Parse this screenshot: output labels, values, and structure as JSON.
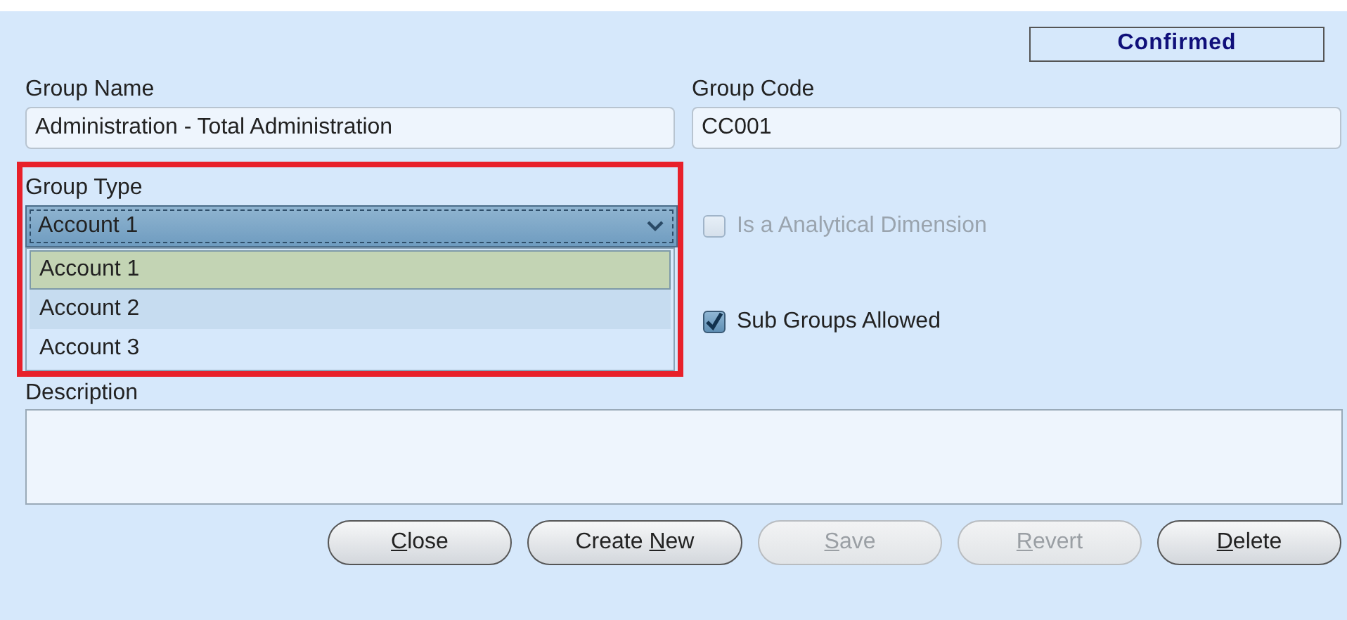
{
  "status": "Confirmed",
  "group_name": {
    "label": "Group Name",
    "value": "Administration - Total Administration"
  },
  "group_code": {
    "label": "Group Code",
    "value": "CC001"
  },
  "group_type": {
    "label": "Group Type",
    "value": "Account 1",
    "expanded": true,
    "options": [
      {
        "label": "Account 1",
        "selected": true
      },
      {
        "label": "Account 2",
        "selected": false
      },
      {
        "label": "Account 3",
        "selected": false
      }
    ]
  },
  "checkboxes": [
    {
      "label": "Is a Analytical Dimension",
      "checked": false,
      "disabled": true
    },
    {
      "label": "Sub Groups Allowed",
      "checked": true,
      "disabled": false
    }
  ],
  "description": {
    "label": "Description"
  },
  "buttons": [
    {
      "key": "C",
      "post": "lose",
      "disabled": false
    },
    {
      "pre": "Create ",
      "key": "N",
      "post": "ew",
      "disabled": false
    },
    {
      "key": "S",
      "post": "ave",
      "disabled": true
    },
    {
      "key": "R",
      "post": "evert",
      "disabled": true
    },
    {
      "key": "D",
      "post": "elete",
      "disabled": false
    }
  ],
  "highlight": true
}
